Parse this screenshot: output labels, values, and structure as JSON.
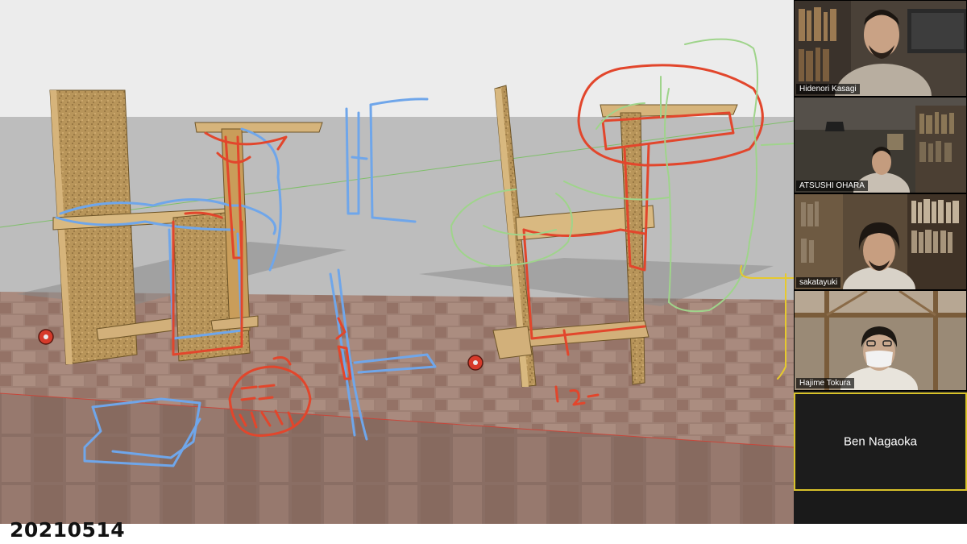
{
  "stage": {
    "annotation_colors": {
      "red": "#e2462c",
      "blue": "#6fa6ea",
      "green": "#9fd48b",
      "yellow": "#e6c92e"
    },
    "model_colors": {
      "wood": "#c9a060",
      "paving": "#a08276",
      "backdrop": "#f1f1f1"
    }
  },
  "caption": {
    "date": "20210514"
  },
  "participants": [
    {
      "name": "Hidenori Kasagi"
    },
    {
      "name": "ATSUSHI OHARA"
    },
    {
      "name": "sakatayuki"
    },
    {
      "name": "Hajime Tokura"
    },
    {
      "name": "Ben Nagaoka",
      "video": false,
      "active_speaker": true
    }
  ]
}
